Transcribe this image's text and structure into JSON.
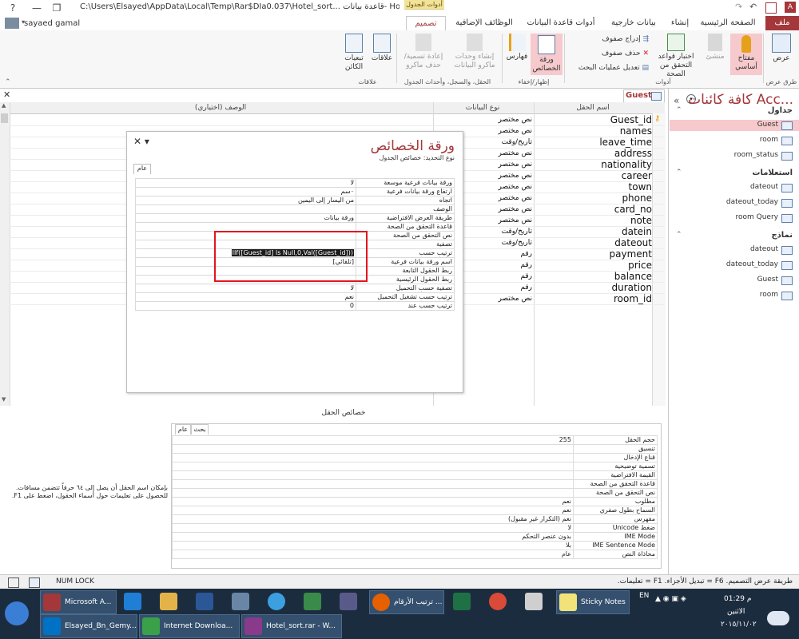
{
  "window": {
    "title": "C:\\Users\\Elsayed\\AppData\\Local\\Temp\\Rar$DIa0.037\\Hotel_sort...  قاعدة بيانات- Hotel_sort :",
    "context_group": "أدوات الجدول",
    "user": "sayaed gamal",
    "help": "?",
    "minimize": "—",
    "restore": "❐",
    "close": "✕"
  },
  "tabs": [
    {
      "label": "ملف"
    },
    {
      "label": "الصفحة الرئيسية"
    },
    {
      "label": "إنشاء"
    },
    {
      "label": "بيانات خارجية"
    },
    {
      "label": "أدوات قاعدة البيانات"
    },
    {
      "label": "الوظائف الإضافية"
    },
    {
      "label": "تصميم"
    }
  ],
  "ribbon": {
    "view": {
      "label": "عرض",
      "group": "طرق عرض"
    },
    "primary_key": {
      "label": "مفتاح أساسي"
    },
    "builder": {
      "label": "منشئ"
    },
    "test_rules": {
      "label": "اختبار قواعد التحقق من الصحة"
    },
    "insert_rows": {
      "label": "إدراج صفوف"
    },
    "delete_rows": {
      "label": "حذف صفوف"
    },
    "modify_lookups": {
      "label": "تعديل عمليات البحث"
    },
    "tools_group": "أدوات",
    "property_sheet": {
      "label": "ورقة الخصائص"
    },
    "indexes": {
      "label": "فهارس"
    },
    "showhide_group": "إظهار/إخفاء",
    "create_macros": {
      "label": "إنشاء وحدات ماكرو البيانات"
    },
    "rename_macro": {
      "label": "إعادة تسمية/حذف ماكرو"
    },
    "events_group": "الحقل، والسجل، وأحداث الجدول",
    "relationships": {
      "label": "علاقات"
    },
    "dependencies": {
      "label": "تبعيات الكائن"
    },
    "relationships_group": "علاقات"
  },
  "document": {
    "tab": "Guest",
    "columns": {
      "field_name": "اسم الحقل",
      "data_type": "نوع البيانات",
      "description": "الوصف (اختياري)"
    },
    "fields": [
      {
        "name": "Guest_id",
        "type": "نص مختصر"
      },
      {
        "name": "names",
        "type": "نص مختصر"
      },
      {
        "name": "leave_time",
        "type": "تاريخ/وقت"
      },
      {
        "name": "address",
        "type": "نص مختصر"
      },
      {
        "name": "nationality",
        "type": "نص مختصر"
      },
      {
        "name": "career",
        "type": "نص مختصر"
      },
      {
        "name": "town",
        "type": "نص مختصر"
      },
      {
        "name": "phone",
        "type": "نص مختصر"
      },
      {
        "name": "card_no",
        "type": "نص مختصر"
      },
      {
        "name": "note",
        "type": "نص مختصر"
      },
      {
        "name": "datein",
        "type": "تاريخ/وقت"
      },
      {
        "name": "dateout",
        "type": "تاريخ/وقت"
      },
      {
        "name": "payment",
        "type": "رقم"
      },
      {
        "name": "price",
        "type": "رقم"
      },
      {
        "name": "balance",
        "type": "رقم"
      },
      {
        "name": "duration",
        "type": "رقم"
      },
      {
        "name": "room_id",
        "type": "نص مختصر"
      }
    ]
  },
  "property_sheet": {
    "title": "ورقة الخصائص",
    "selection": "نوع التحديد: خصائص الجدول",
    "tab": "عام",
    "rows": [
      {
        "label": "ورقة بيانات فرعية موسعة",
        "value": "لا"
      },
      {
        "label": "ارتفاع ورقة بيانات فرعية",
        "value": "٠سم"
      },
      {
        "label": "اتجاه",
        "value": "من اليسار إلى اليمين"
      },
      {
        "label": "الوصف",
        "value": ""
      },
      {
        "label": "طريقة العرض الافتراضية",
        "value": "ورقة بيانات"
      },
      {
        "label": "قاعدة التحقق من الصحة",
        "value": ""
      },
      {
        "label": "نص التحقق من الصحة",
        "value": ""
      },
      {
        "label": "تصفية",
        "value": ""
      },
      {
        "label": "ترتيب حسب",
        "value": "IIf([Guest_id] Is Null,0,Val([Guest_id]))"
      },
      {
        "label": "اسم ورقة بيانات فرعية",
        "value": "[تلقائي]"
      },
      {
        "label": "ربط الحقول التابعة",
        "value": ""
      },
      {
        "label": "ربط الحقول الرئيسية",
        "value": ""
      },
      {
        "label": "تصفية حسب التحميل",
        "value": "لا"
      },
      {
        "label": "ترتيب حسب تشغيل التحميل",
        "value": "نعم"
      },
      {
        "label": "ترتيب حسب عند",
        "value": "0"
      }
    ]
  },
  "field_properties": {
    "caption": "خصائص الحقل",
    "tab_general": "عام",
    "tab_lookup": "بحث",
    "rows": [
      {
        "label": "حجم الحقل",
        "value": "255"
      },
      {
        "label": "تنسيق",
        "value": ""
      },
      {
        "label": "قناع الإدخال",
        "value": ""
      },
      {
        "label": "تسمية توضيحية",
        "value": ""
      },
      {
        "label": "القيمة الافتراضية",
        "value": ""
      },
      {
        "label": "قاعدة التحقق من الصحة",
        "value": ""
      },
      {
        "label": "نص التحقق من الصحة",
        "value": ""
      },
      {
        "label": "مطلوب",
        "value": "نعم"
      },
      {
        "label": "السماح بطول صفري",
        "value": "نعم"
      },
      {
        "label": "مفهرس",
        "value": "نعم (التكرار غير مقبول)"
      },
      {
        "label": "ضغط Unicode",
        "value": "لا"
      },
      {
        "label": "IME Mode",
        "value": "بدون عنصر التحكم"
      },
      {
        "label": "IME Sentence Mode",
        "value": "بلا"
      },
      {
        "label": "محاذاة النص",
        "value": "عام"
      }
    ],
    "hint": "بإمكان اسم الحقل أن يصل إلى ٦٤ حرفاً تتضمن مسافات. للحصول على تعليمات حول أسماء الحقول، اضغط على F1."
  },
  "nav_pane": {
    "title": "كافة كائنات Acc...",
    "sections": [
      {
        "title": "جداول",
        "items": [
          "Guest",
          "room",
          "room_status"
        ]
      },
      {
        "title": "استعلامات",
        "items": [
          "dateout",
          "dateout_today",
          "room Query"
        ]
      },
      {
        "title": "نماذج",
        "items": [
          "dateout",
          "dateout_today",
          "Guest",
          "room"
        ]
      }
    ]
  },
  "statusbar": {
    "message": "طريقة عرض التصميم. F6 = تبديل الأجزاء. F1 = تعليمات.",
    "numlock": "NUM LOCK"
  },
  "taskbar": {
    "buttons": [
      {
        "label": "Microsoft A..."
      },
      {
        "label": "ترتيب الأرقام ..."
      },
      {
        "label": "Sticky Notes"
      },
      {
        "label": "Elsayed_Bn_Gemy..."
      },
      {
        "label": "Internet Downloa..."
      },
      {
        "label": "Hotel_sort.rar - W..."
      }
    ],
    "lang": "EN",
    "time": "01:29 م",
    "day": "الاثنين",
    "date": "٢٠١٥/١١/٠٢"
  },
  "colors": {
    "accent": "#a4373a",
    "highlight": "#e2151e",
    "taskbar": "#1c2c3f"
  }
}
